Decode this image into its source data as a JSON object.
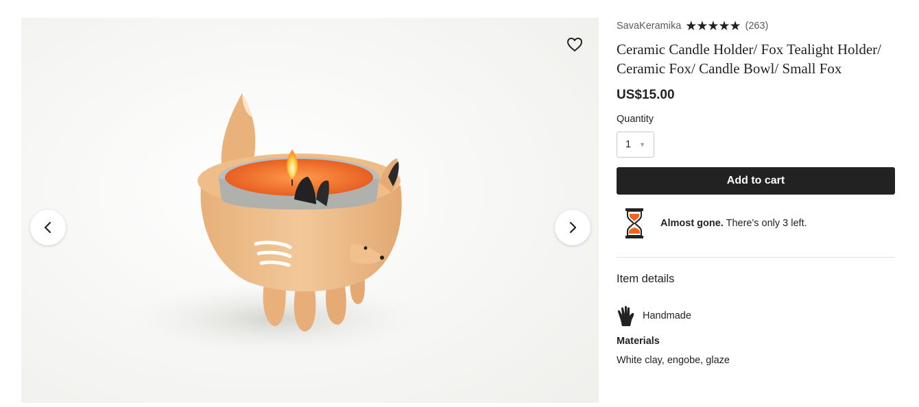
{
  "gallery": {
    "image_alt": "Ceramic fox tealight holder with lit candle",
    "prev_icon": "chevron-left-icon",
    "next_icon": "chevron-right-icon",
    "favorite_icon": "heart-outline-icon"
  },
  "listing": {
    "shop_name": "SavaKeramika",
    "rating_stars": 5,
    "review_count": "(263)",
    "title": "Ceramic Candle Holder/ Fox Tealight Holder/ Ceramic Fox/ Candle Bowl/ Small Fox",
    "price": "US$15.00",
    "quantity_label": "Quantity",
    "quantity_value": "1",
    "add_to_cart_label": "Add to cart",
    "stock_strong": "Almost gone.",
    "stock_text": " There's only 3 left.",
    "stock_icon": "hourglass-icon"
  },
  "item_details": {
    "title": "Item details",
    "handmade_icon": "hand-icon",
    "handmade_label": "Handmade",
    "materials_title": "Materials",
    "materials_value": "White clay, engobe, glaze"
  },
  "colors": {
    "button_dark": "#222222",
    "text_muted": "#595959",
    "hourglass_accent": "#f1641e"
  }
}
